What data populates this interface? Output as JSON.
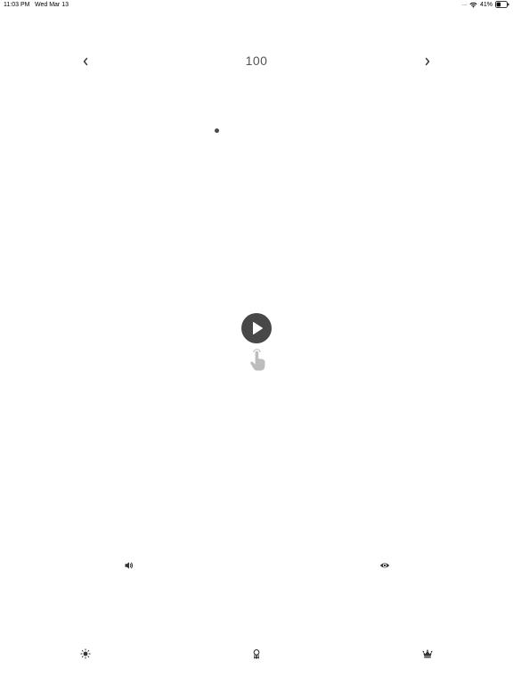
{
  "status_bar": {
    "time": "11:03 PM",
    "date": "Wed Mar 13",
    "signal": ".....",
    "battery_percent": "41%",
    "battery_level": 0.41
  },
  "level": {
    "number": "100"
  },
  "icons": {
    "prev": "chevron-left-icon",
    "next": "chevron-right-icon",
    "play": "play-icon",
    "tap_hint": "tap-hand-icon",
    "sound": "speaker-icon",
    "visibility": "eye-icon",
    "brightness": "sun-icon",
    "achievements": "award-ribbon-icon",
    "premium": "crown-icon"
  },
  "colors": {
    "background": "#ffffff",
    "play_button": "#484848",
    "dot": "#4a4a4a",
    "tap_hint": "#bdbdbd"
  }
}
